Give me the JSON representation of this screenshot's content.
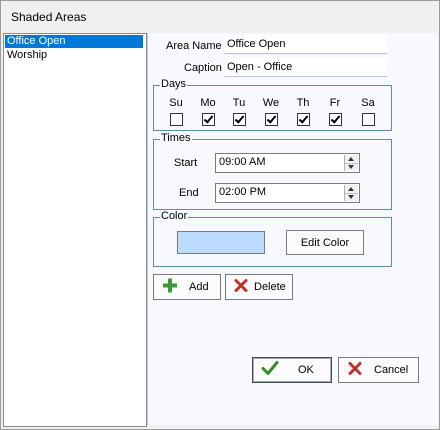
{
  "window": {
    "title": "Shaded Areas"
  },
  "areas": [
    {
      "label": "Office Open",
      "selected": true
    },
    {
      "label": "Worship",
      "selected": false
    }
  ],
  "form": {
    "area_name_label": "Area Name",
    "area_name_value": "Office Open",
    "caption_label": "Caption",
    "caption_value": "Open - Office"
  },
  "days": {
    "legend": "Days",
    "items": [
      {
        "label": "Su",
        "checked": false
      },
      {
        "label": "Mo",
        "checked": true
      },
      {
        "label": "Tu",
        "checked": true
      },
      {
        "label": "We",
        "checked": true
      },
      {
        "label": "Th",
        "checked": true
      },
      {
        "label": "Fr",
        "checked": true
      },
      {
        "label": "Sa",
        "checked": false
      }
    ]
  },
  "times": {
    "legend": "Times",
    "start_label": "Start",
    "start_value": "09:00 AM",
    "end_label": "End",
    "end_value": "02:00 PM"
  },
  "color": {
    "legend": "Color",
    "swatch": "#bcdcff",
    "edit_label": "Edit Color"
  },
  "actions": {
    "add_label": "Add",
    "add_icon": "plus-icon",
    "delete_label": "Delete",
    "delete_icon": "x-icon",
    "ok_label": "OK",
    "ok_icon": "check-icon",
    "cancel_label": "Cancel",
    "cancel_icon": "x-icon"
  },
  "colors": {
    "selection": "#0078d7",
    "group_border": "#5b8ea6",
    "plus_green": "#3a9a3a",
    "delete_red": "#c0302a",
    "check_green": "#3a8a2a"
  }
}
